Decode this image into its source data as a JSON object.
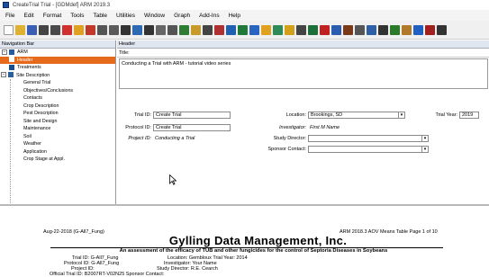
{
  "window": {
    "title": "CreateTrial Trial - [GDMdef] ARM 2019.3"
  },
  "menu": [
    "File",
    "Edit",
    "Format",
    "Tools",
    "Table",
    "Utilities",
    "Window",
    "Graph",
    "Add-Ins",
    "Help"
  ],
  "toolbar": {
    "icons": [
      {
        "name": "new-icon",
        "color": "#ffffff"
      },
      {
        "name": "open-icon",
        "color": "#e0b030"
      },
      {
        "name": "save-icon",
        "color": "#3b5fb5"
      },
      {
        "name": "print-icon",
        "color": "#444444"
      },
      {
        "name": "print-preview-icon",
        "color": "#4a4a4a"
      },
      {
        "name": "close-icon",
        "color": "#d03030"
      },
      {
        "name": "folder-icon",
        "color": "#e0a020"
      },
      {
        "name": "report-icon",
        "color": "#c0392b"
      },
      {
        "name": "wizard-icon",
        "color": "#555555"
      },
      {
        "name": "envelope-icon",
        "color": "#5a5a5a"
      },
      {
        "name": "tools-icon",
        "color": "#333333"
      },
      {
        "name": "table-icon",
        "color": "#2c6bb3"
      },
      {
        "name": "grid-icon",
        "color": "#333333"
      },
      {
        "name": "undo-icon",
        "color": "#666666"
      },
      {
        "name": "cut-icon",
        "color": "#555555"
      },
      {
        "name": "copy-icon",
        "color": "#2e7d32"
      },
      {
        "name": "paste-icon",
        "color": "#c79a2a"
      },
      {
        "name": "filter-icon",
        "color": "#444444"
      },
      {
        "name": "sort-icon",
        "color": "#b03030"
      },
      {
        "name": "sort-desc-icon",
        "color": "#2060b0"
      },
      {
        "name": "chart-icon",
        "color": "#1f7a3a"
      },
      {
        "name": "map-icon",
        "color": "#2b64c0"
      },
      {
        "name": "palette-icon",
        "color": "#e0a020"
      },
      {
        "name": "globe-icon",
        "color": "#2e8b57"
      },
      {
        "name": "lightbulb-icon",
        "color": "#d4a017"
      },
      {
        "name": "check-icon",
        "color": "#444444"
      },
      {
        "name": "excel-icon",
        "color": "#1d6f3a"
      },
      {
        "name": "red-square-icon",
        "color": "#c02020"
      },
      {
        "name": "calendar-icon",
        "color": "#2a5db0"
      },
      {
        "name": "book-icon",
        "color": "#7a3a1a"
      },
      {
        "name": "table2-icon",
        "color": "#555555"
      },
      {
        "name": "layout-icon",
        "color": "#2f5fa5"
      },
      {
        "name": "stop-icon",
        "color": "#333333"
      },
      {
        "name": "record-icon",
        "color": "#2a7a2a"
      },
      {
        "name": "paint-icon",
        "color": "#b07a2a"
      },
      {
        "name": "help-icon",
        "color": "#2060c0"
      },
      {
        "name": "calendar2-icon",
        "color": "#a02020"
      },
      {
        "name": "bug-icon",
        "color": "#333333"
      }
    ]
  },
  "nav": {
    "header": "Navigation Bar",
    "root": "ARM",
    "items": [
      {
        "label": "Header",
        "selected": true,
        "level": 1
      },
      {
        "label": "Treatments",
        "level": 1
      },
      {
        "label": "Site Description",
        "level": 1
      },
      {
        "label": "General Trial",
        "level": 2
      },
      {
        "label": "Objectives/Conclusions",
        "level": 2
      },
      {
        "label": "Contacts",
        "level": 2
      },
      {
        "label": "Crop Description",
        "level": 2
      },
      {
        "label": "Pest Description",
        "level": 2
      },
      {
        "label": "Site and Design",
        "level": 2
      },
      {
        "label": "Maintenance",
        "level": 2
      },
      {
        "label": "Soil",
        "level": 2
      },
      {
        "label": "Weather",
        "level": 2
      },
      {
        "label": "Application",
        "level": 2
      },
      {
        "label": "Crop Stage at Appl.",
        "level": 2
      }
    ]
  },
  "header_pane": {
    "title_bar": "Header",
    "title_label": "Title:",
    "description": "Conducting a Trial with ARM - tutorial video series",
    "trial_id_label": "Trial ID:",
    "trial_id": "Create Trial",
    "protocol_id_label": "Protocol ID:",
    "protocol_id": "Create Trial",
    "project_id_label": "Project ID:",
    "project_id": "Conducting a Trial",
    "location_label": "Location:",
    "location": "Brookings, SD",
    "investigator_label": "Investigator:",
    "investigator": "First M Name",
    "study_director_label": "Study Director:",
    "study_director": "",
    "sponsor_contact_label": "Sponsor Contact:",
    "sponsor_contact": "",
    "trial_year_label": "Trial Year:",
    "trial_year": "2019"
  },
  "report": {
    "date": "Aug-22-2018 (G-All7_Fung)",
    "page_info": "ARM 2018.3 AOV Means Table Page 1 of 10",
    "company": "Gylling Data Management, Inc.",
    "subtitle": "An assessment of the efficacy of TUB and other fungicides for the control of Septoria Diseases in Soybeans",
    "lines": [
      "Trial ID: G-All7_Fung",
      "Location: Gembloux   Trial Year: 2014",
      "Protocol ID: G-All7_Fung",
      "Investigator: Your Name",
      "Project ID:",
      "Study Director: R.E. Cearch",
      "Official Trial ID: B2007RT-V02N25   Sponsor Contact:"
    ]
  }
}
